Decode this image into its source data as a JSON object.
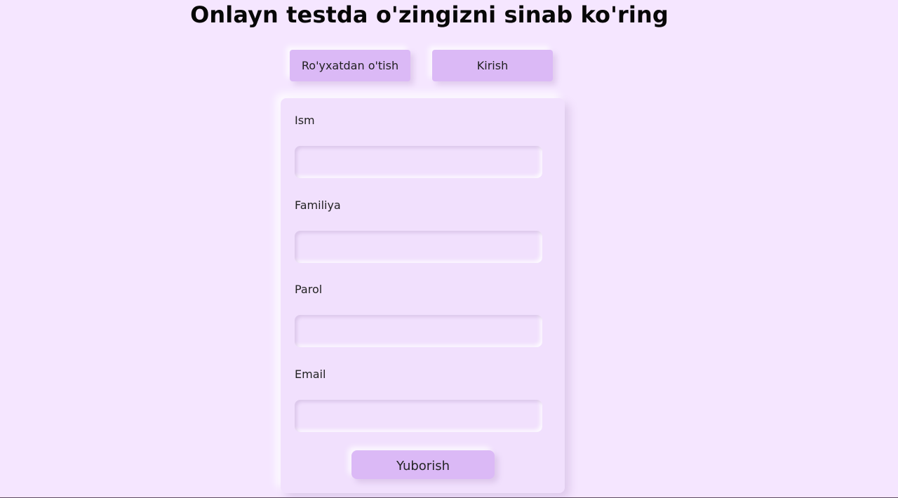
{
  "header": {
    "title": "Onlayn testda o'zingizni sinab ko'ring"
  },
  "nav": {
    "register_label": "Ro'yxatdan o'tish",
    "login_label": "Kirish"
  },
  "form": {
    "fields": [
      {
        "label": "Ism",
        "value": "",
        "placeholder": ""
      },
      {
        "label": "Familiya",
        "value": "",
        "placeholder": ""
      },
      {
        "label": "Parol",
        "value": "",
        "placeholder": ""
      },
      {
        "label": "Email",
        "value": "",
        "placeholder": ""
      }
    ],
    "submit_label": "Yuborish"
  },
  "colors": {
    "background": "#f5e6ff",
    "card": "#f1e0fd",
    "button": "#dbb9f6",
    "text": "#070707"
  }
}
